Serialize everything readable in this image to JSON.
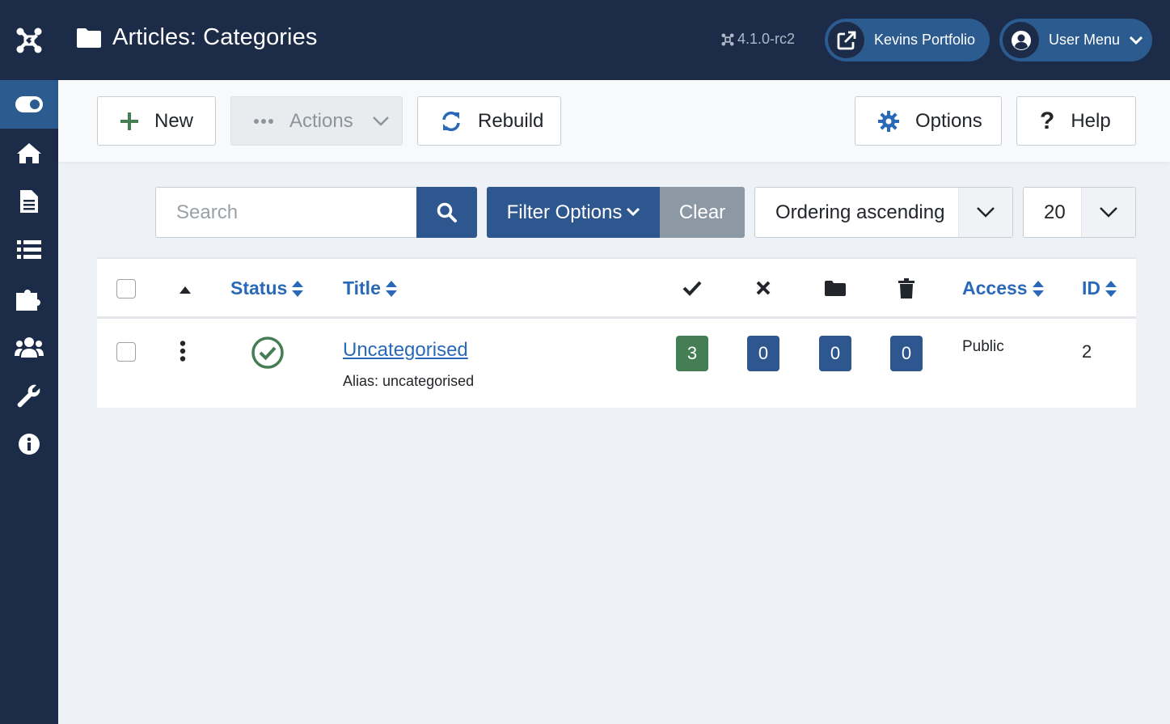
{
  "header": {
    "title": "Articles: Categories",
    "version": "4.1.0-rc2",
    "site_link_label": "Kevins Portfolio",
    "user_menu_label": "User Menu"
  },
  "sidebar": {
    "items": [
      {
        "icon": "toggle-menu-icon",
        "active": true
      },
      {
        "icon": "home-icon"
      },
      {
        "icon": "content-file-icon"
      },
      {
        "icon": "menus-list-icon"
      },
      {
        "icon": "components-puzzle-icon"
      },
      {
        "icon": "users-icon"
      },
      {
        "icon": "system-wrench-icon"
      },
      {
        "icon": "help-info-icon"
      }
    ]
  },
  "toolbar": {
    "new_label": "New",
    "actions_label": "Actions",
    "rebuild_label": "Rebuild",
    "options_label": "Options",
    "help_label": "Help"
  },
  "filters": {
    "search_placeholder": "Search",
    "search_value": "",
    "filter_options_label": "Filter Options",
    "clear_label": "Clear",
    "ordering_value": "Ordering ascending",
    "limit_value": "20"
  },
  "table": {
    "headers": {
      "status": "Status",
      "title": "Title",
      "published_icon": "check-icon",
      "unpublished_icon": "times-icon",
      "archived_icon": "folder-icon",
      "trashed_icon": "trash-icon",
      "access": "Access",
      "id": "ID"
    },
    "rows": [
      {
        "title": "Uncategorised",
        "alias_label": "Alias:",
        "alias": "uncategorised",
        "status": "published",
        "published_count": "3",
        "unpublished_count": "0",
        "archived_count": "0",
        "trashed_count": "0",
        "access": "Public",
        "id": "2"
      }
    ]
  },
  "colors": {
    "sidebar_bg": "#1c2b48",
    "primary": "#2e568f",
    "link": "#2a69b8",
    "success": "#457d54",
    "clear_bg": "#8d98a5"
  }
}
